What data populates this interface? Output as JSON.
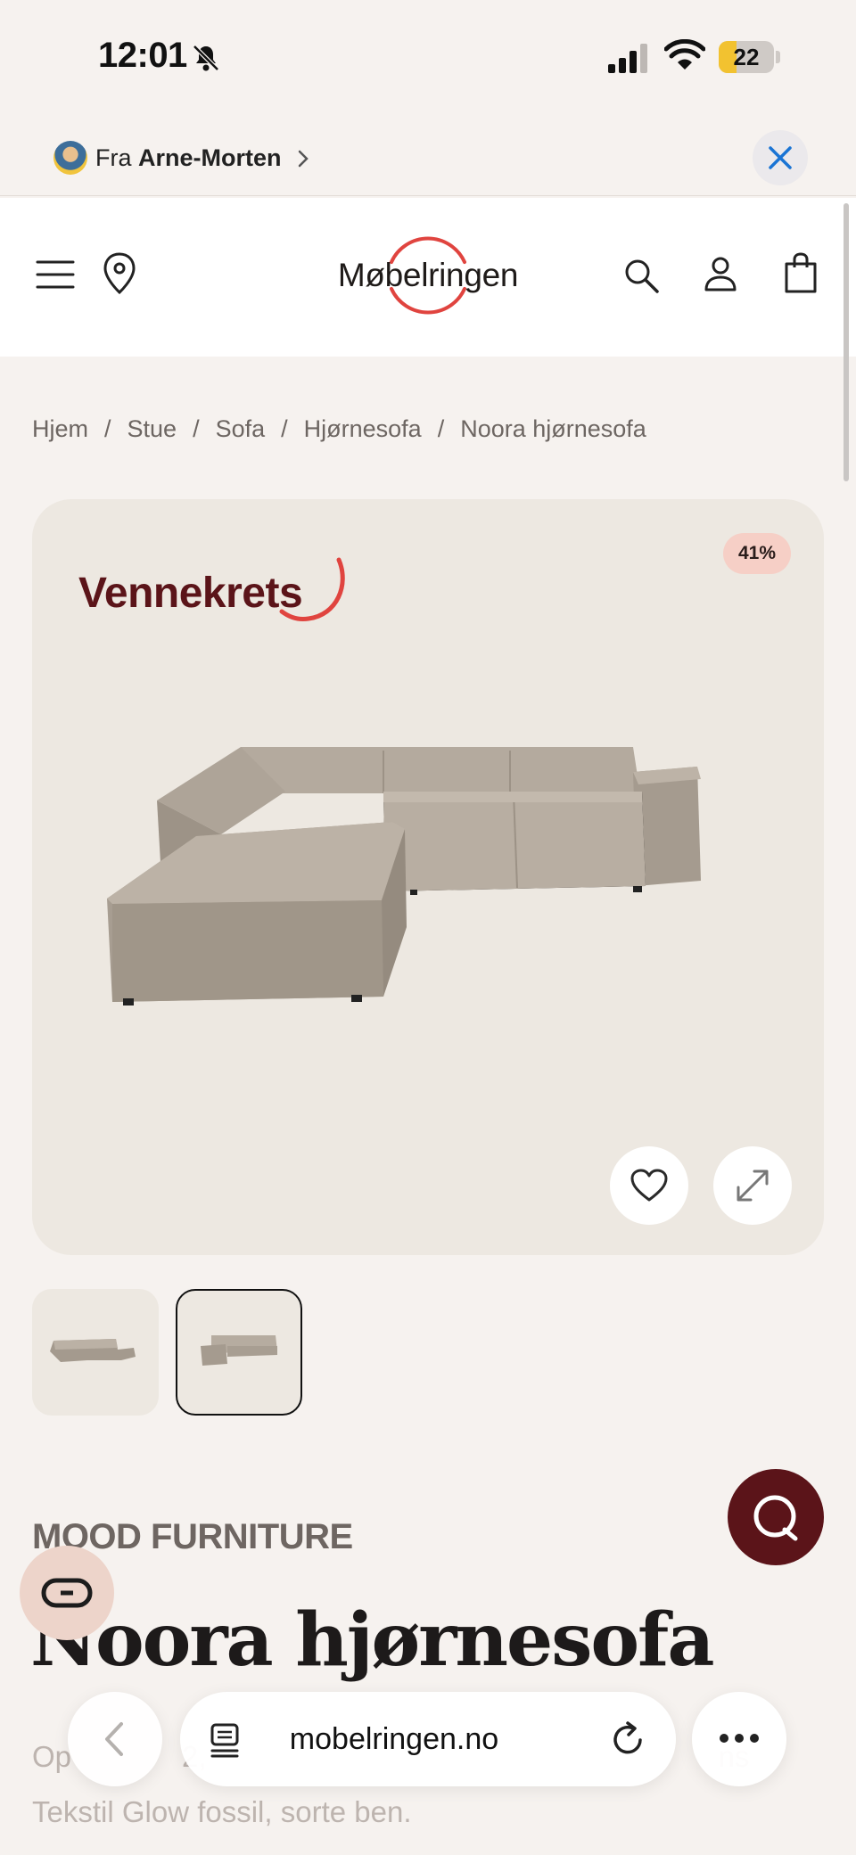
{
  "status_bar": {
    "time": "12:01",
    "battery": "22",
    "battery_level": 0.22
  },
  "referral": {
    "prefix": "Fra",
    "name": "Arne-Morten"
  },
  "header": {
    "logo_text": "Møbelringen"
  },
  "breadcrumb": [
    "Hjem",
    "Stue",
    "Sofa",
    "Hjørnesofa",
    "Noora hjørnesofa"
  ],
  "product": {
    "campaign": "Vennekrets",
    "discount": "41%",
    "brand": "MOOD FURNITURE",
    "title": "Noora hjørnesofa",
    "description_line1": "Op",
    "description_mid": "2,",
    "description_end": "ns",
    "description_line2": "Tekstil Glow fossil, sorte ben.",
    "thumbnails": [
      "thumbnail-1",
      "thumbnail-2"
    ]
  },
  "browser": {
    "url": "mobelringen.no"
  },
  "colors": {
    "brand_red": "#e0443f",
    "campaign": "#5b1419",
    "badge": "#f6cfc6",
    "background": "#f6f2ef"
  },
  "icons": [
    "bell-slash-icon",
    "signal-icon",
    "wifi-icon",
    "close-icon",
    "menu-icon",
    "location-pin-icon",
    "search-icon",
    "account-icon",
    "bag-icon",
    "heart-icon",
    "expand-icon",
    "chat-icon",
    "loop-icon",
    "back-icon",
    "tabs-icon",
    "reload-icon",
    "more-icon"
  ]
}
